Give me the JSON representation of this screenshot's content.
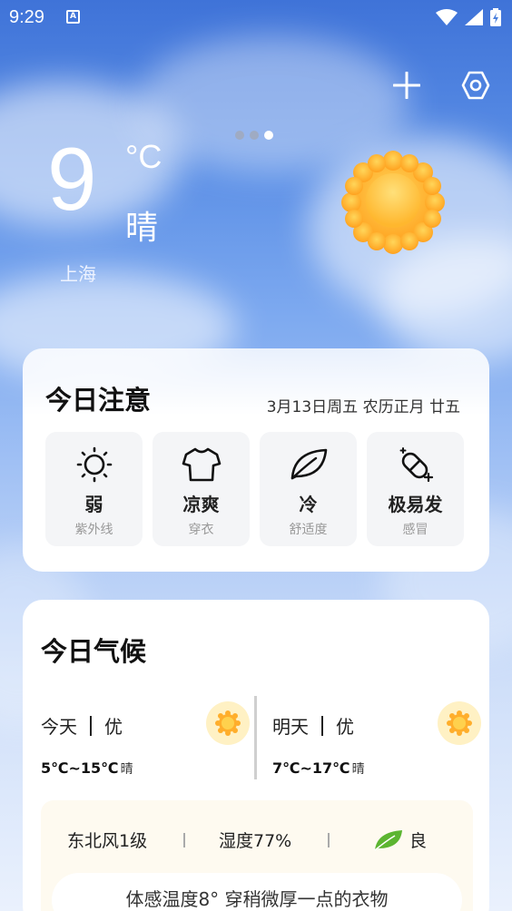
{
  "status_bar": {
    "time": "9:29",
    "notification_icon": "A"
  },
  "current": {
    "temperature": "9",
    "unit": "°C",
    "condition": "晴",
    "city": "上海",
    "icon": "sun-icon"
  },
  "pager": {
    "count": 3,
    "active_index": 2
  },
  "notice": {
    "title": "今日注意",
    "date": "3月13日周五 农历正月 廿五",
    "tiles": [
      {
        "value": "弱",
        "label": "紫外线",
        "icon": "uv-sun-icon"
      },
      {
        "value": "凉爽",
        "label": "穿衣",
        "icon": "tshirt-icon"
      },
      {
        "value": "冷",
        "label": "舒适度",
        "icon": "leaf-icon"
      },
      {
        "value": "极易发",
        "label": "感冒",
        "icon": "pill-icon"
      }
    ]
  },
  "climate": {
    "title": "今日气候",
    "today": {
      "day": "今天",
      "quality": "优",
      "range": "5℃~15℃",
      "condition": "晴"
    },
    "tomorrow": {
      "day": "明天",
      "quality": "优",
      "range": "7℃~17℃",
      "condition": "晴"
    },
    "wind": "东北风1级",
    "humidity": "湿度77%",
    "air": "良",
    "feel": "体感温度8° 穿稍微厚一点的衣物"
  },
  "colors": {
    "sky_top": "#3f73d8",
    "sun": "#ffb12e",
    "leaf": "#5cb531"
  }
}
